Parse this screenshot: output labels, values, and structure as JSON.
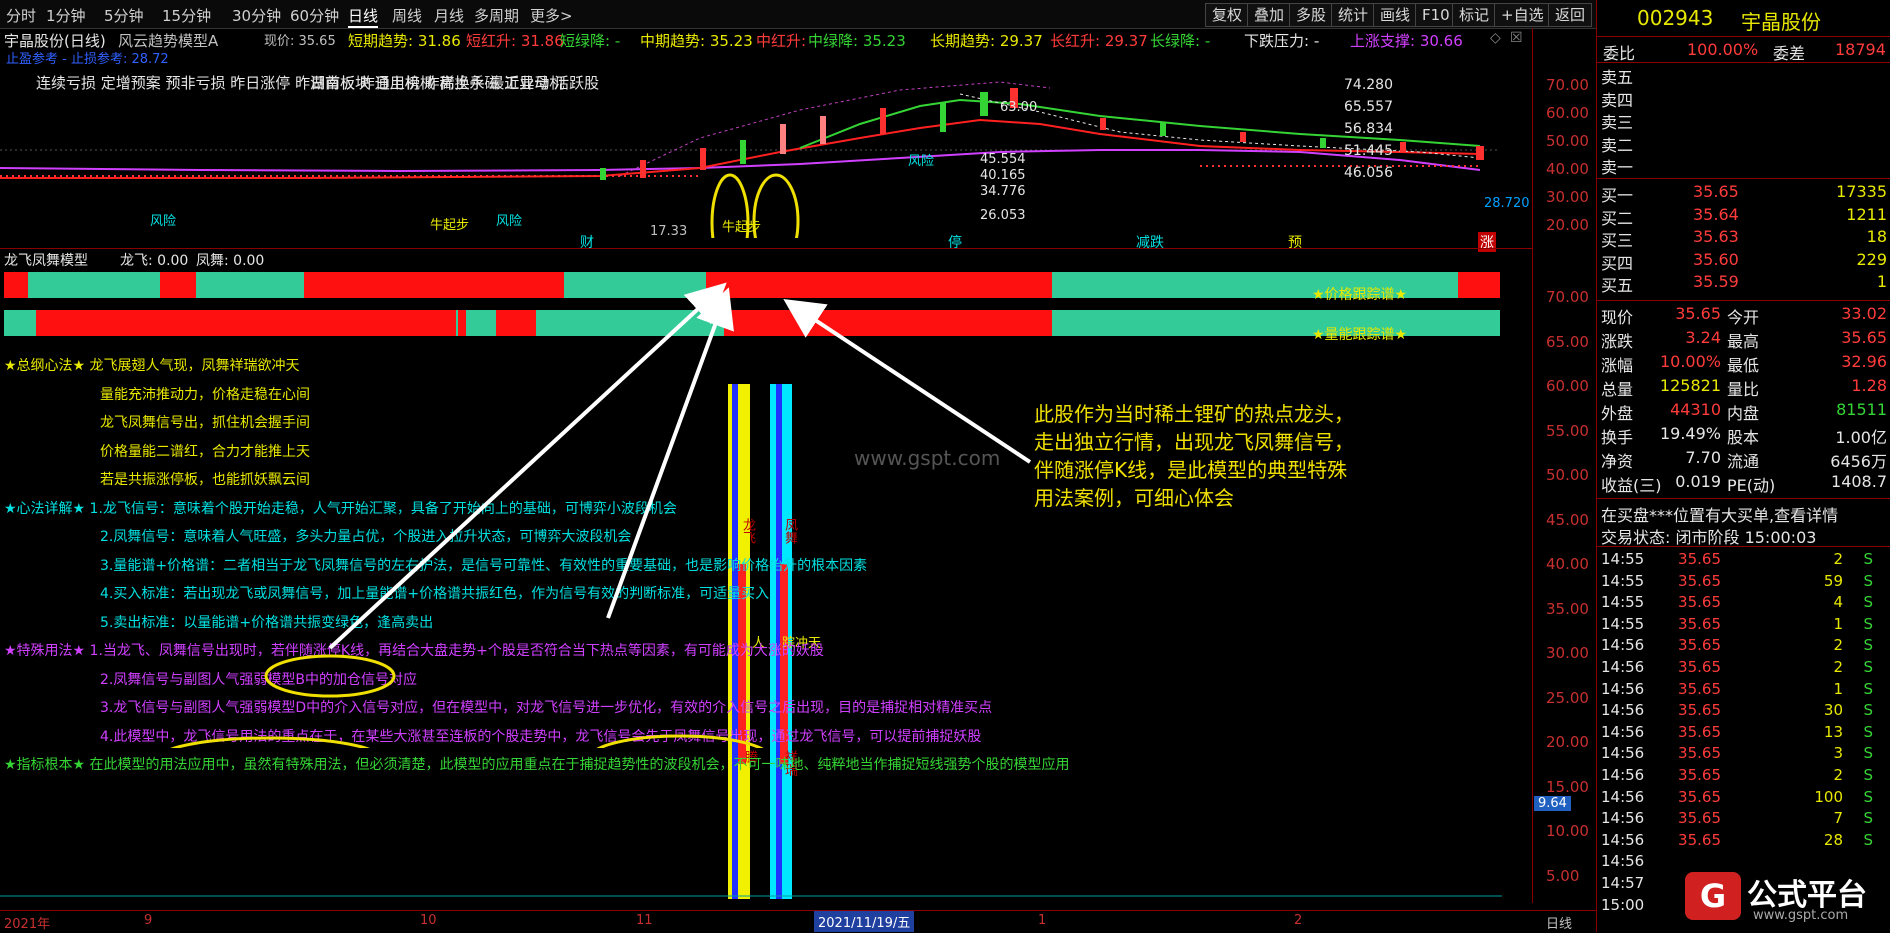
{
  "toolbar": {
    "periods": [
      "分时",
      "1分钟",
      "5分钟",
      "15分钟",
      "30分钟",
      "60分钟",
      "日线",
      "周线",
      "月线",
      "多周期",
      "更多>"
    ],
    "right_buttons": [
      "复权",
      "叠加",
      "多股",
      "统计",
      "画线",
      "F10",
      "标记",
      "+自选",
      "返回"
    ]
  },
  "chart": {
    "stock_title": "宇晶股份(日线)",
    "model_name": "风云趋势模型A",
    "current_price": "现价: 35.65",
    "short_trend": "短期趋势: 31.86",
    "short_red": "短红升: 31.86",
    "short_green": "短绿降: -",
    "mid_trend": "中期趋势: 35.23",
    "mid_red": "中红升: -",
    "mid_green": "中绿降: 35.23",
    "long_trend": "长期趋势: 29.37",
    "long_red": "长红升: 29.37",
    "long_green": "长绿降: -",
    "pressure": "下跌压力: -",
    "support": "上涨支撑: 30.66",
    "stop_loss": "止盈参考 - 止损参考: 28.72",
    "concepts": "连续亏损 定增预案 预非亏损 昨日涨停 昨日首板 昨日上榜 昨高换手 最近异动 活跃股",
    "concepts2": "湖南板块   通用机械   稀土永磁 工业母机",
    "price_labels": [
      "74.280",
      "65.557",
      "56.834",
      "51.445",
      "46.056",
      "45.554",
      "40.165",
      "34.776",
      "26.053"
    ],
    "low_label": "17.33",
    "peak_label": "63.00",
    "y_ticks": [
      "70.00",
      "60.00",
      "50.00",
      "40.00",
      "30.00",
      "20.00"
    ],
    "last_price_tag": "28.720",
    "markers": [
      "财",
      "停",
      "减跌",
      "预",
      "涨"
    ],
    "kline_marks": [
      "牛起步",
      "风险",
      "风险",
      "牛起步",
      "风险"
    ]
  },
  "indicator": {
    "title": "龙飞凤舞模型",
    "dragon": "龙飞: 0.00",
    "phoenix": "凤舞: 0.00",
    "bar1_label": "★价格跟踪谱★",
    "bar2_label": "★量能跟踪谱★",
    "y_ticks": [
      "70.00",
      "65.00",
      "60.00",
      "55.00",
      "50.00",
      "45.00",
      "40.00",
      "35.00",
      "30.00",
      "25.00",
      "20.00",
      "15.00",
      "10.00",
      "5.00"
    ],
    "cur_value": "9.64",
    "col_labels": [
      "龙飞",
      "凤舞",
      "人",
      "踪冲天",
      "腾",
      "祥瑞"
    ]
  },
  "rules": [
    {
      "text": "★总纲心法★  龙飞展翅人气现，凤舞祥瑞欲冲天",
      "color": "#e8e800"
    },
    {
      "text": "量能充沛推动力，价格走稳在心间",
      "color": "#e8e800"
    },
    {
      "text": "龙飞凤舞信号出，抓住机会握手间",
      "color": "#e8e800"
    },
    {
      "text": "价格量能二谱红，合力才能推上天",
      "color": "#e8e800"
    },
    {
      "text": "若是共振涨停板，也能抓妖飘云间",
      "color": "#e8e800"
    },
    {
      "text": "★心法详解★  1.龙飞信号：意味着个股开始走稳，人气开始汇聚，具备了开始向上的基础，可博弈小波段机会",
      "color": "#00e0e0"
    },
    {
      "text": "2.凤舞信号：意味着人气旺盛，多头力量占优，个股进入拉升状态，可博弈大波段机会",
      "color": "#00e0e0"
    },
    {
      "text": "3.量能谱+价格谱：二者相当于龙飞凤舞信号的左右护法，是信号可靠性、有效性的重要基础，也是影响价格抬升的根本因素",
      "color": "#00e0e0"
    },
    {
      "text": "4.买入标准：若出现龙飞或凤舞信号，加上量能谱+价格谱共振红色，作为信号有效的判断标准，可适量买入",
      "color": "#00e0e0"
    },
    {
      "text": "5.卖出标准：以量能谱+价格谱共振变绿色，逢高卖出",
      "color": "#00e0e0"
    },
    {
      "text": "★特殊用法★  1.当龙飞、凤舞信号出现时，若伴随涨停K线，再结合大盘走势+个股是否符合当下热点等因素，有可能成为大涨的妖股",
      "color": "#d040ff"
    },
    {
      "text": "2.凤舞信号与副图人气强弱模型B中的加仓信号对应",
      "color": "#d040ff"
    },
    {
      "text": "3.龙飞信号与副图人气强弱模型D中的介入信号对应，但在模型中，对龙飞信号进一步优化，有效的介入信号之后出现，目的是捕捉相对精准买点",
      "color": "#d040ff"
    },
    {
      "text": "4.此模型中，龙飞信号用法的重点在于，在某些大涨甚至连板的个股走势中，龙飞信号会先于凤舞信号出现，通过龙飞信号，可以提前捕捉妖股",
      "color": "#d040ff"
    },
    {
      "text": "★指标根本★  在此模型的用法应用中，虽然有特殊用法，但必须清楚，此模型的应用重点在于捕捉趋势性的波段机会，不可一味地、纯粹地当作捕捉短线强势个股的模型应用",
      "color": "#35d435"
    }
  ],
  "annotation": {
    "lines": [
      "此股作为当时稀土锂矿的热点龙头，",
      "走出独立行情，出现龙飞凤舞信号，",
      "伴随涨停K线，是此模型的典型特殊",
      "用法案例，可细心体会"
    ],
    "watermark": "www.gspt.com"
  },
  "date_axis": {
    "labels": [
      "2021年",
      "9",
      "10",
      "11",
      "2021/11/19/五",
      "1",
      "2"
    ],
    "period": "日线"
  },
  "panel": {
    "code": "002943",
    "name": "宇晶股份",
    "weibi_label": "委比",
    "weibi": "100.00%",
    "weicha_label": "委差",
    "weicha": "18794",
    "asks": [
      {
        "label": "卖五",
        "price": "",
        "vol": ""
      },
      {
        "label": "卖四",
        "price": "",
        "vol": ""
      },
      {
        "label": "卖三",
        "price": "",
        "vol": ""
      },
      {
        "label": "卖二",
        "price": "",
        "vol": ""
      },
      {
        "label": "卖一",
        "price": "",
        "vol": ""
      }
    ],
    "bids": [
      {
        "label": "买一",
        "price": "35.65",
        "vol": "17335"
      },
      {
        "label": "买二",
        "price": "35.64",
        "vol": "1211"
      },
      {
        "label": "买三",
        "price": "35.63",
        "vol": "18"
      },
      {
        "label": "买四",
        "price": "35.60",
        "vol": "229"
      },
      {
        "label": "买五",
        "price": "35.59",
        "vol": "1"
      }
    ],
    "stats": [
      {
        "l1": "现价",
        "v1": "35.65",
        "c1": "red",
        "l2": "今开",
        "v2": "33.02",
        "c2": "red"
      },
      {
        "l1": "涨跌",
        "v1": "3.24",
        "c1": "red",
        "l2": "最高",
        "v2": "35.65",
        "c2": "red"
      },
      {
        "l1": "涨幅",
        "v1": "10.00%",
        "c1": "red",
        "l2": "最低",
        "v2": "32.96",
        "c2": "red"
      },
      {
        "l1": "总量",
        "v1": "125821",
        "c1": "yel",
        "l2": "量比",
        "v2": "1.28",
        "c2": "red"
      },
      {
        "l1": "外盘",
        "v1": "44310",
        "c1": "red",
        "l2": "内盘",
        "v2": "81511",
        "c2": "grn"
      },
      {
        "l1": "换手",
        "v1": "19.49%",
        "c1": "wht",
        "l2": "股本",
        "v2": "1.00亿",
        "c2": "wht"
      },
      {
        "l1": "净资",
        "v1": "7.70",
        "c1": "wht",
        "l2": "流通",
        "v2": "6456万",
        "c2": "wht"
      },
      {
        "l1": "收益(三)",
        "v1": "0.019",
        "c1": "wht",
        "l2": "PE(动)",
        "v2": "1408.7",
        "c2": "wht"
      }
    ],
    "notice": "在买盘***位置有大买单,查看详情",
    "trade_state": "交易状态: 闭市阶段 15:00:03",
    "ticks": [
      {
        "t": "14:55",
        "p": "35.65",
        "v": "2",
        "s": "S"
      },
      {
        "t": "14:55",
        "p": "35.65",
        "v": "59",
        "s": "S"
      },
      {
        "t": "14:55",
        "p": "35.65",
        "v": "4",
        "s": "S"
      },
      {
        "t": "14:55",
        "p": "35.65",
        "v": "1",
        "s": "S"
      },
      {
        "t": "14:56",
        "p": "35.65",
        "v": "2",
        "s": "S"
      },
      {
        "t": "14:56",
        "p": "35.65",
        "v": "2",
        "s": "S"
      },
      {
        "t": "14:56",
        "p": "35.65",
        "v": "1",
        "s": "S"
      },
      {
        "t": "14:56",
        "p": "35.65",
        "v": "30",
        "s": "S"
      },
      {
        "t": "14:56",
        "p": "35.65",
        "v": "13",
        "s": "S"
      },
      {
        "t": "14:56",
        "p": "35.65",
        "v": "3",
        "s": "S"
      },
      {
        "t": "14:56",
        "p": "35.65",
        "v": "2",
        "s": "S"
      },
      {
        "t": "14:56",
        "p": "35.65",
        "v": "100",
        "s": "S"
      },
      {
        "t": "14:56",
        "p": "35.65",
        "v": "7",
        "s": "S"
      },
      {
        "t": "14:56",
        "p": "35.65",
        "v": "28",
        "s": "S"
      },
      {
        "t": "14:56",
        "p": "",
        "v": "",
        "s": ""
      },
      {
        "t": "14:57",
        "p": "",
        "v": "",
        "s": ""
      },
      {
        "t": "15:00",
        "p": "",
        "v": "",
        "s": ""
      }
    ],
    "logo_text": "公式平台",
    "logo_url": "www.gspt.com",
    "logo_mark": "G"
  }
}
